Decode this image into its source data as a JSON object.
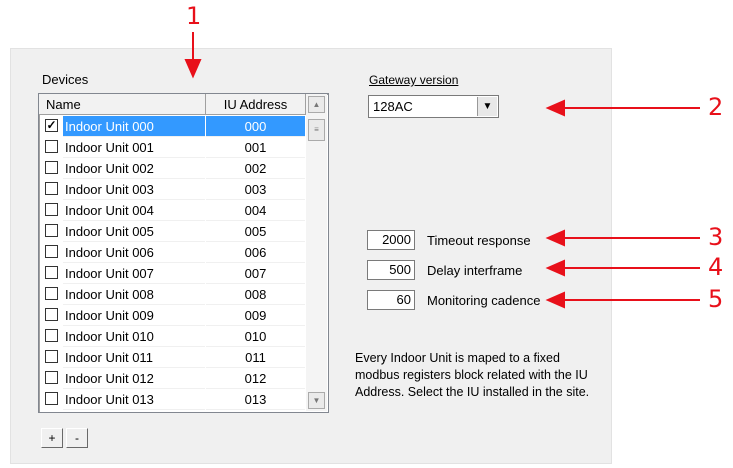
{
  "devices": {
    "label": "Devices",
    "columns": [
      "Name",
      "IU Address"
    ],
    "rows": [
      {
        "name": "Indoor Unit 000",
        "address": "000",
        "checked": true
      },
      {
        "name": "Indoor Unit 001",
        "address": "001",
        "checked": false
      },
      {
        "name": "Indoor Unit 002",
        "address": "002",
        "checked": false
      },
      {
        "name": "Indoor Unit 003",
        "address": "003",
        "checked": false
      },
      {
        "name": "Indoor Unit 004",
        "address": "004",
        "checked": false
      },
      {
        "name": "Indoor Unit 005",
        "address": "005",
        "checked": false
      },
      {
        "name": "Indoor Unit 006",
        "address": "006",
        "checked": false
      },
      {
        "name": "Indoor Unit 007",
        "address": "007",
        "checked": false
      },
      {
        "name": "Indoor Unit 008",
        "address": "008",
        "checked": false
      },
      {
        "name": "Indoor Unit 009",
        "address": "009",
        "checked": false
      },
      {
        "name": "Indoor Unit 010",
        "address": "010",
        "checked": false
      },
      {
        "name": "Indoor Unit 011",
        "address": "011",
        "checked": false
      },
      {
        "name": "Indoor Unit 012",
        "address": "012",
        "checked": false
      },
      {
        "name": "Indoor Unit 013",
        "address": "013",
        "checked": false
      }
    ],
    "add_label": "+",
    "remove_label": "-"
  },
  "gateway": {
    "label": "Gateway version",
    "value": "128AC"
  },
  "settings": {
    "timeout": {
      "value": "2000",
      "label": "Timeout response"
    },
    "delay": {
      "value": "500",
      "label": "Delay interframe"
    },
    "monitoring": {
      "value": "60",
      "label": "Monitoring cadence"
    }
  },
  "description": "Every Indoor Unit is maped to a fixed modbus registers block related with the IU Address. Select the IU installed in the site.",
  "callouts": [
    "1",
    "2",
    "3",
    "4",
    "5"
  ],
  "colors": {
    "accent": "#e8101a",
    "selection": "#3399ff"
  }
}
